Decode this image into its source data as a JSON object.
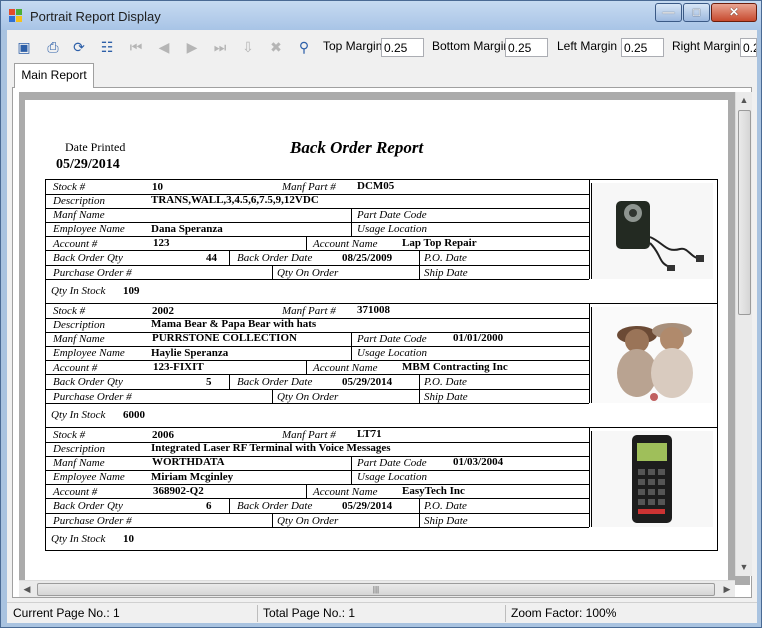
{
  "window": {
    "title": "Portrait Report Display",
    "minimize": "—",
    "maximize": "□",
    "close": "✕"
  },
  "toolbar": {
    "icons": [
      "export-icon",
      "print-icon",
      "refresh-icon",
      "tree-icon",
      "first-page-icon",
      "prev-page-icon",
      "next-page-icon",
      "last-page-icon",
      "goto-page-icon",
      "stop-icon",
      "find-icon"
    ],
    "top_margin_label": "Top Margin",
    "top_margin_value": "0.25",
    "bottom_margin_label": "Bottom Margin",
    "bottom_margin_value": "0.25",
    "left_margin_label": "Left Margin",
    "left_margin_value": "0.25",
    "right_margin_label": "Right Margin",
    "right_margin_value": "0.2"
  },
  "tabs": [
    {
      "label": "Main Report"
    }
  ],
  "report": {
    "title": "Back Order Report",
    "date_printed_label": "Date Printed",
    "date_printed_value": "05/29/2014",
    "labels": {
      "stock": "Stock #",
      "manf_part": "Manf Part #",
      "description": "Description",
      "manf_name": "Manf Name",
      "part_date_code": "Part Date Code",
      "employee_name": "Employee Name",
      "usage_location": "Usage Location",
      "account": "Account #",
      "account_name": "Account Name",
      "back_order_qty": "Back Order Qty",
      "back_order_date": "Back Order Date",
      "po_date": "P.O. Date",
      "purchase_order": "Purchase Order #",
      "qty_on_order": "Qty On Order",
      "ship_date": "Ship Date",
      "qty_in_stock": "Qty In Stock"
    },
    "records": [
      {
        "stock": "10",
        "manf_part": "DCM05",
        "description": "TRANS,WALL,3,4.5,6,7.5,9,12VDC",
        "manf_name": "",
        "part_date_code": "",
        "employee_name": "Dana Speranza",
        "usage_location": "",
        "account": "123",
        "account_name": "Lap Top Repair",
        "back_order_qty": "44",
        "back_order_date": "08/25/2009",
        "po_date": "",
        "purchase_order": "",
        "qty_on_order": "",
        "ship_date": "",
        "qty_in_stock": "109",
        "image": "power-adapter-photo"
      },
      {
        "stock": "2002",
        "manf_part": "371008",
        "description": "Mama Bear & Papa Bear with hats",
        "manf_name": "PURRSTONE COLLECTION",
        "part_date_code": "01/01/2000",
        "employee_name": "Haylie Speranza",
        "usage_location": "",
        "account": "123-FIXIT",
        "account_name": "MBM Contracting Inc",
        "back_order_qty": "5",
        "back_order_date": "05/29/2014",
        "po_date": "",
        "purchase_order": "",
        "qty_on_order": "",
        "ship_date": "",
        "qty_in_stock": "6000",
        "image": "bear-figurine-photo"
      },
      {
        "stock": "2006",
        "manf_part": "LT71",
        "description": "Integrated Laser RF Terminal with Voice Messages",
        "manf_name": "WORTHDATA",
        "part_date_code": "01/03/2004",
        "employee_name": "Miriam Mcginley",
        "usage_location": "",
        "account": "368902-Q2",
        "account_name": "EasyTech Inc",
        "back_order_qty": "6",
        "back_order_date": "05/29/2014",
        "po_date": "",
        "purchase_order": "",
        "qty_on_order": "",
        "ship_date": "",
        "qty_in_stock": "10",
        "image": "rf-terminal-photo"
      }
    ]
  },
  "status": {
    "current_page": "Current Page No.: 1",
    "total_page": "Total Page No.: 1",
    "zoom": "Zoom Factor: 100%"
  }
}
